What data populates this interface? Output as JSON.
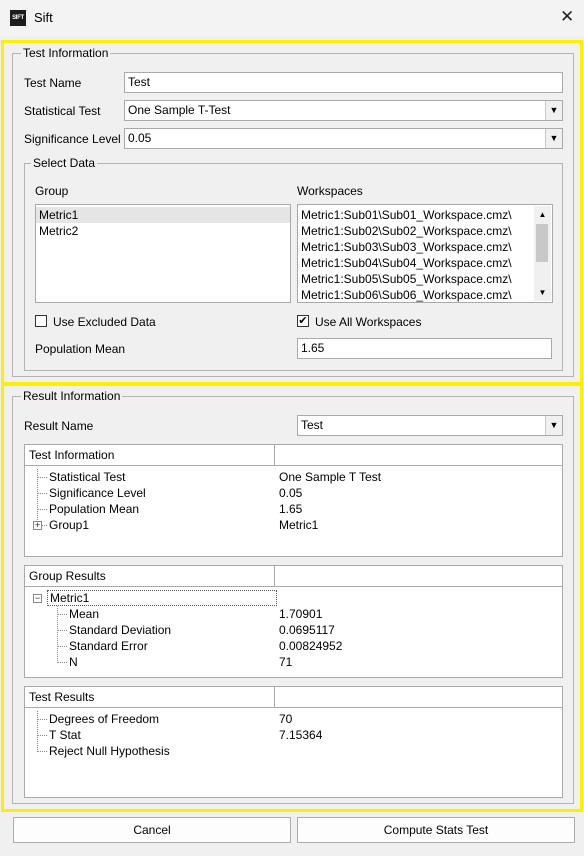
{
  "window": {
    "title": "Sift",
    "app_icon_text": "SIFT",
    "close_glyph": "✕"
  },
  "test_info": {
    "legend": "Test Information",
    "test_name_label": "Test Name",
    "test_name_value": "Test",
    "statistical_test_label": "Statistical Test",
    "statistical_test_value": "One Sample T-Test",
    "significance_label": "Significance Level",
    "significance_value": "0.05",
    "select_data": {
      "legend": "Select Data",
      "group_label": "Group",
      "workspaces_label": "Workspaces",
      "groups": [
        "Metric1",
        "Metric2"
      ],
      "workspaces": [
        "Metric1:Sub01\\Sub01_Workspace.cmz\\",
        "Metric1:Sub02\\Sub02_Workspace.cmz\\",
        "Metric1:Sub03\\Sub03_Workspace.cmz\\",
        "Metric1:Sub04\\Sub04_Workspace.cmz\\",
        "Metric1:Sub05\\Sub05_Workspace.cmz\\",
        "Metric1:Sub06\\Sub06_Workspace.cmz\\"
      ],
      "use_excluded_label": "Use Excluded Data",
      "use_excluded_checked": false,
      "use_all_ws_label": "Use All Workspaces",
      "use_all_ws_checked": true,
      "pop_mean_label": "Population Mean",
      "pop_mean_value": "1.65"
    }
  },
  "result_info": {
    "legend": "Result Information",
    "result_name_label": "Result Name",
    "result_name_value": "Test",
    "test_info_table": {
      "header": "Test Information",
      "rows": [
        {
          "name": "Statistical Test",
          "value": "One Sample T Test"
        },
        {
          "name": "Significance Level",
          "value": "0.05"
        },
        {
          "name": "Population Mean",
          "value": "1.65"
        },
        {
          "name": "Group1",
          "value": "Metric1"
        }
      ]
    },
    "group_results_table": {
      "header": "Group Results",
      "parent": "Metric1",
      "rows": [
        {
          "name": "Mean",
          "value": "1.70901"
        },
        {
          "name": "Standard Deviation",
          "value": "0.0695117"
        },
        {
          "name": "Standard Error",
          "value": "0.00824952"
        },
        {
          "name": "N",
          "value": "71"
        }
      ]
    },
    "test_results_table": {
      "header": "Test Results",
      "rows": [
        {
          "name": "Degrees of Freedom",
          "value": "70"
        },
        {
          "name": "T Stat",
          "value": "7.15364"
        },
        {
          "name": "Reject Null Hypothesis",
          "value": ""
        }
      ]
    }
  },
  "buttons": {
    "cancel": "Cancel",
    "compute": "Compute Stats Test"
  },
  "colors": {
    "highlight": "#ffee00",
    "background": "#f0f0f0"
  },
  "icons": {
    "combo_arrow": "▼",
    "scroll_up": "▲",
    "scroll_down": "▼",
    "check": "✔",
    "expand": "+",
    "collapse": "−"
  }
}
